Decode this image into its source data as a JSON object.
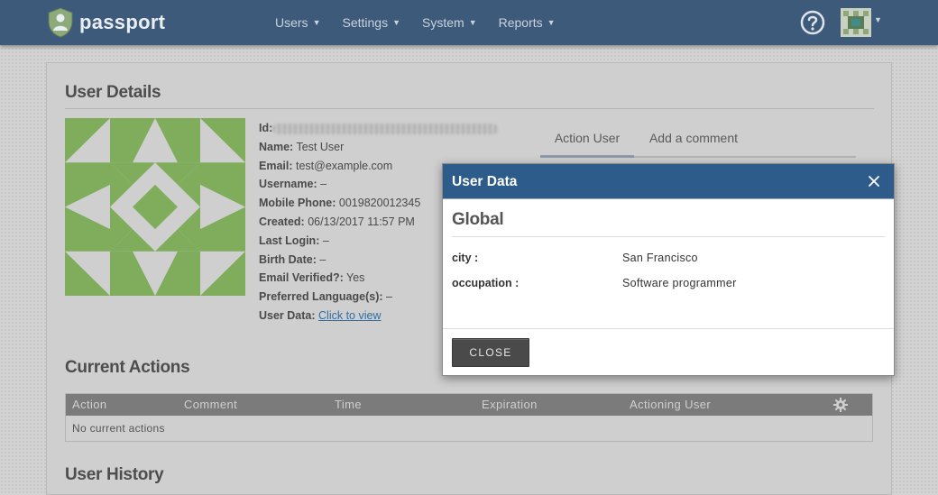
{
  "brand": {
    "name": "passport",
    "logo_icon": "passport-logo-icon"
  },
  "nav": {
    "items": [
      {
        "label": "Users"
      },
      {
        "label": "Settings"
      },
      {
        "label": "System"
      },
      {
        "label": "Reports"
      }
    ]
  },
  "header": {
    "help_icon": "question-circle-icon",
    "avatar_icon": "identicon-avatar"
  },
  "panel": {
    "title": "User Details"
  },
  "user": {
    "id_label": "Id:",
    "name_label": "Name:",
    "name": "Test User",
    "email_label": "Email:",
    "email": "test@example.com",
    "username_label": "Username:",
    "username": "–",
    "mobile_label": "Mobile Phone:",
    "mobile": "0019820012345",
    "created_label": "Created:",
    "created": "06/13/2017 11:57 PM",
    "last_login_label": "Last Login:",
    "last_login": "–",
    "birth_label": "Birth Date:",
    "birth": "–",
    "verified_label": "Email Verified?:",
    "verified": "Yes",
    "lang_label": "Preferred Language(s):",
    "lang": "–",
    "data_label": "User Data:",
    "data_link": "Click to view"
  },
  "tabs": [
    {
      "label": "Action User"
    },
    {
      "label": "Add a comment"
    }
  ],
  "actions": {
    "title": "Current Actions",
    "columns": [
      "Action",
      "Comment",
      "Time",
      "Expiration",
      "Actioning User"
    ],
    "empty": "No current actions"
  },
  "history": {
    "title": "User History"
  },
  "modal": {
    "title": "User Data",
    "section": "Global",
    "rows": [
      {
        "key": "city :",
        "value": "San Francisco"
      },
      {
        "key": "occupation :",
        "value": "Software programmer"
      }
    ],
    "close_label": "CLOSE"
  },
  "colors": {
    "topbar": "#3e5a7a",
    "identicon": "#7fad5c",
    "modal_header": "#2d5c8a",
    "close_button": "#4a4a4a"
  }
}
